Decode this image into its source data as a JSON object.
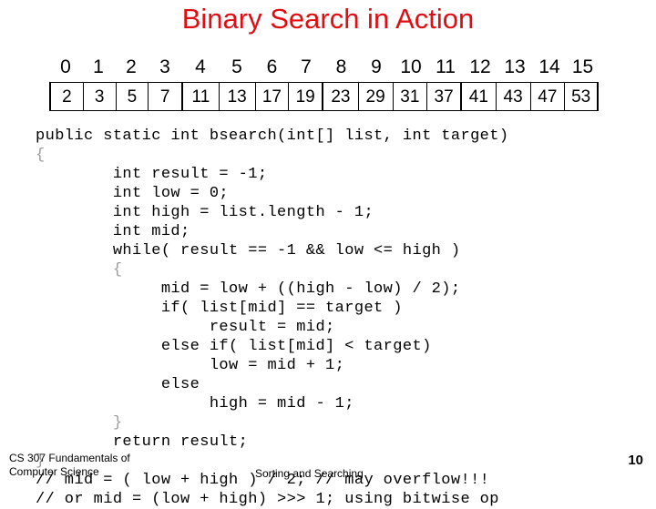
{
  "slide": {
    "title": "Binary Search in Action",
    "title_color": "#E00E12",
    "page_number": "10"
  },
  "array_diagram": {
    "indices": [
      "0",
      "1",
      "2",
      "3",
      "4",
      "5",
      "6",
      "7",
      "8",
      "9",
      "10",
      "11",
      "12",
      "13",
      "14",
      "15"
    ],
    "values": [
      "2",
      "3",
      "5",
      "7",
      "11",
      "13",
      "17",
      "19",
      "23",
      "29",
      "31",
      "37",
      "41",
      "43",
      "47",
      "53"
    ],
    "group_size": 4
  },
  "code": {
    "lines": [
      {
        "indent": 0,
        "text": "public static int bsearch(int[] list, int target)"
      },
      {
        "indent": 0,
        "text": "{",
        "gray": true
      },
      {
        "indent": 8,
        "text": "int result = -1;"
      },
      {
        "indent": 8,
        "text": "int low = 0;"
      },
      {
        "indent": 8,
        "text": "int high = list.length - 1;"
      },
      {
        "indent": 8,
        "text": "int mid;"
      },
      {
        "indent": 8,
        "text": "while( result == -1 && low <= high )"
      },
      {
        "indent": 8,
        "text": "{",
        "gray": true
      },
      {
        "indent": 13,
        "text": "mid = low + ((high - low) / 2);"
      },
      {
        "indent": 13,
        "text": "if( list[mid] == target )"
      },
      {
        "indent": 18,
        "text": "result = mid;"
      },
      {
        "indent": 13,
        "text": "else if( list[mid] < target)"
      },
      {
        "indent": 18,
        "text": "low = mid + 1;"
      },
      {
        "indent": 13,
        "text": "else"
      },
      {
        "indent": 18,
        "text": "high = mid - 1;"
      },
      {
        "indent": 8,
        "text": "}",
        "gray": true
      },
      {
        "indent": 8,
        "text": "return result;"
      },
      {
        "indent": 0,
        "text": "}",
        "gray": true
      },
      {
        "indent": 0,
        "text": "// mid = ( low + high ) / 2; // may overflow!!!"
      },
      {
        "indent": 0,
        "text": "// or mid = (low + high) >>> 1; using bitwise op"
      }
    ]
  },
  "footer": {
    "course_line1": "CS 307 Fundamentals of",
    "course_line2": "Computer Science",
    "topic": "Sorting and Searching"
  }
}
